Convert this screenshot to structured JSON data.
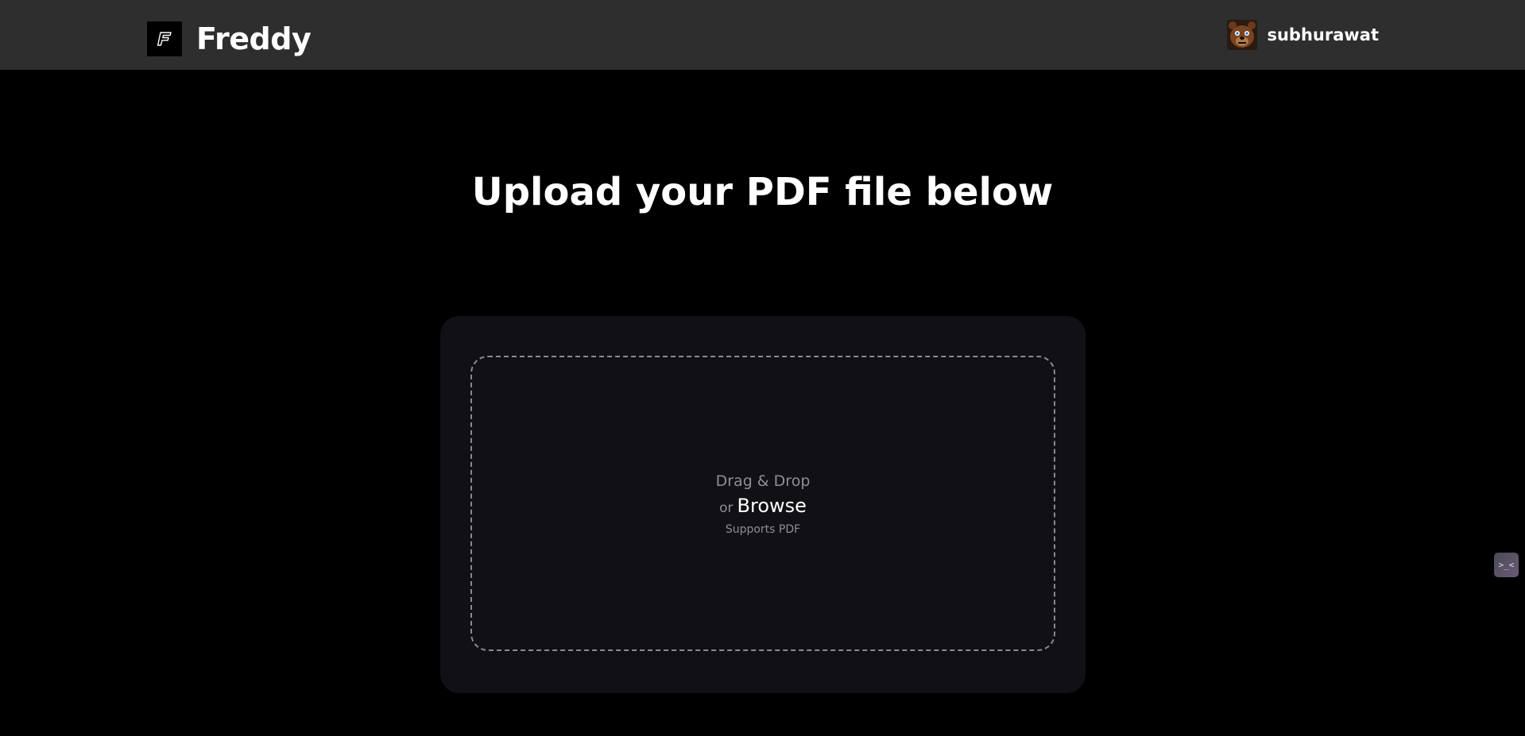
{
  "header": {
    "brand": "Freddy",
    "logo_icon": "freddy-f-logo-icon",
    "username": "subhurawat",
    "avatar_icon": "freddy-bear-avatar"
  },
  "main": {
    "title": "Upload your PDF file below",
    "dropzone": {
      "drag_text": "Drag & Drop",
      "or_text": "or",
      "browse_text": "Browse",
      "supports_text": "Supports PDF"
    }
  },
  "widget": {
    "icon": "face-widget-icon",
    "glyph": ">_<"
  },
  "colors": {
    "navbar": "#2e2e2e",
    "background": "#000000",
    "card": "#111115",
    "muted_text": "#8e8e93"
  }
}
